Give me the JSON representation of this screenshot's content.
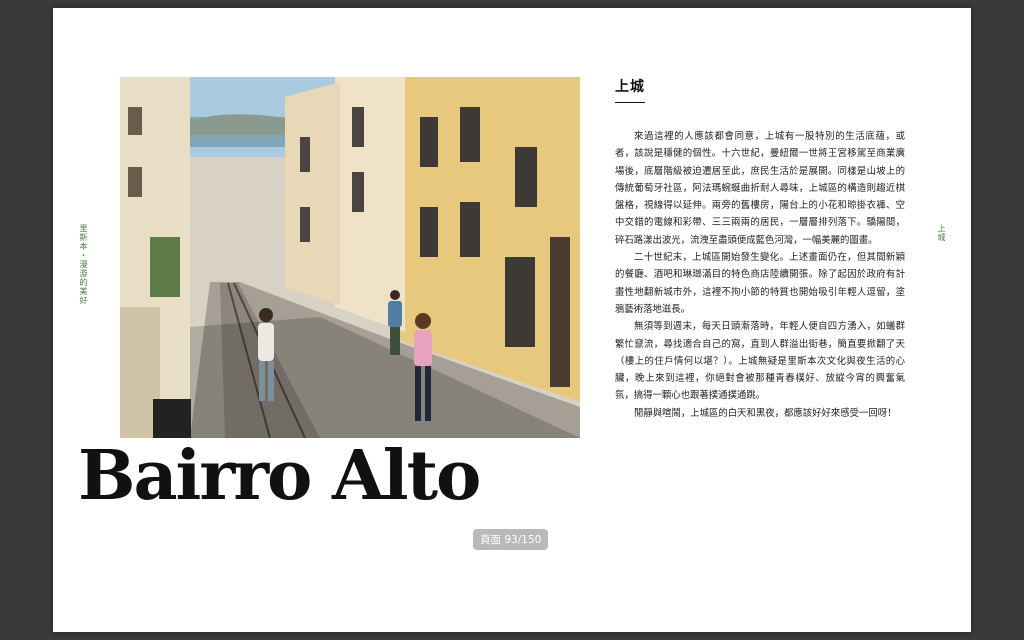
{
  "side_label_left": "里斯本・漫游的美好",
  "side_label_right": "上城",
  "photo": {
    "icon": "street-photo-tram-lisbon"
  },
  "headline": "Bairro Alto",
  "section_title": "上城",
  "paragraphs": [
    "來過這裡的人應該都會同意，上城有一股特別的生活底蘊，或者，該說是穩健的個性。十六世紀，曼紐爾一世將王宮移駕至商業廣場後，底層階級被迫遷居至此，庶民生活於是展開。同樣是山坡上的傳統葡萄牙社區，阿法瑪蜿蜒曲折耐人尋味，上城區的構造則趨近棋盤格，視線得以延伸。兩旁的舊樓房，陽台上的小花和晾掛衣褲、空中交錯的電線和彩帶、三三兩兩的居民，一層層排列落下。驕陽間，碎石路漾出波光，流洩至盡頭便成藍色河灣，一幅美麗的圖畫。",
    "二十世紀末，上城區開始發生變化。上述畫面仍在，但其間新穎的餐廳、酒吧和琳瑯滿目的特色商店陸續開張。除了起因於政府有計畫性地翻新城市外，這裡不拘小節的特質也開始吸引年輕人逗留，塗鴉藝術落地滋長。",
    "無須等到週末，每天日頭漸落時，年輕人便自四方湧入，如蟻群繁忙竄流，尋找適合自己的窩，直到人群溢出街巷，簡直要掀翻了天（樓上的住戶情何以堪？）。上城無疑是里斯本次文化與夜生活的心臟，晚上來到這裡，你絕對會被那種青春樸好、放縱今宵的興奮氣氛，搞得一顆心也跟著撲通撲通跳。",
    "閒靜與喧鬧，上城區的白天和黑夜，都應該好好來感受一回呀！"
  ],
  "page_indicator": "頁面 93/150"
}
